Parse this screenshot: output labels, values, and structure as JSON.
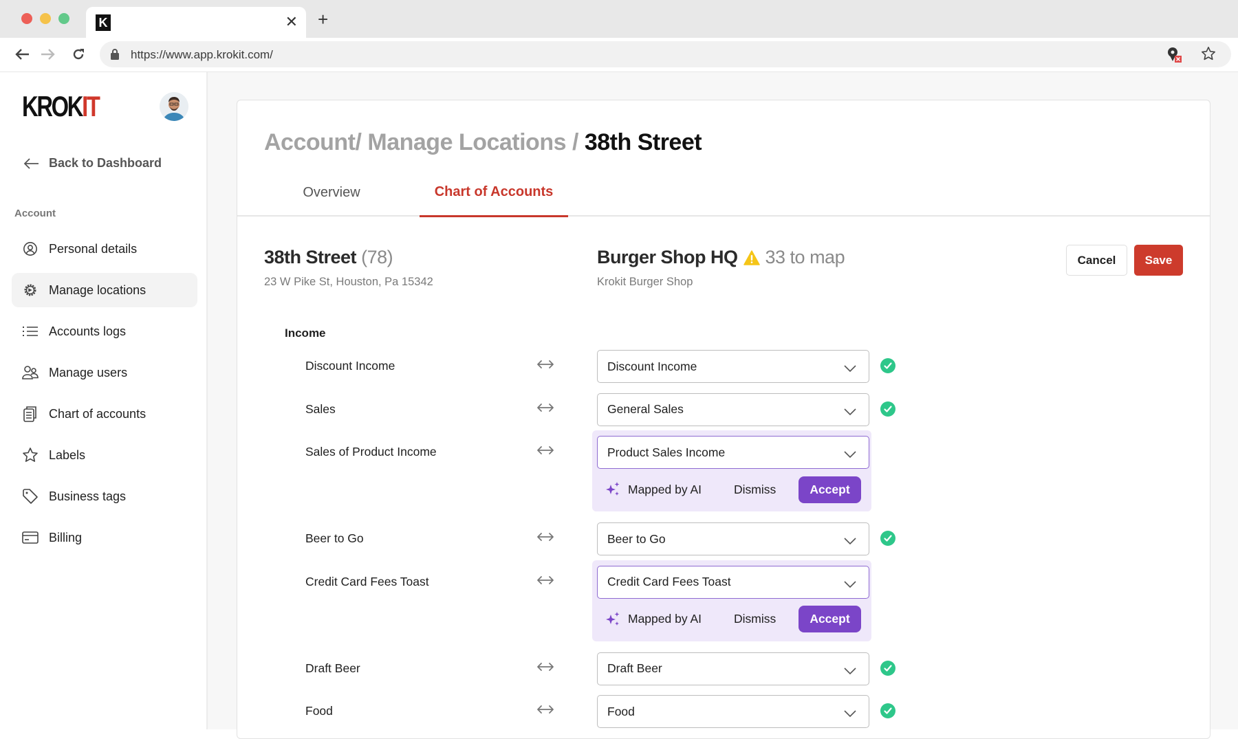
{
  "browser": {
    "tab_favicon": "K",
    "tab_close": "✕",
    "new_tab": "+",
    "url": "https://www.app.krokit.com/",
    "icons": [
      "back-arrow-icon",
      "forward-arrow-icon",
      "reload-icon",
      "lock-icon",
      "extension-blocked-icon",
      "bookmark-star-icon"
    ]
  },
  "sidebar": {
    "logo_part1": "KROK",
    "logo_part2": "IT",
    "back_label": "Back to Dashboard",
    "section_label": "Account",
    "items": [
      {
        "label": "Personal details",
        "icon": "user-circle-icon",
        "active": false
      },
      {
        "label": "Manage locations",
        "icon": "gear-icon",
        "active": true
      },
      {
        "label": "Accounts logs",
        "icon": "list-icon",
        "active": false
      },
      {
        "label": "Manage users",
        "icon": "users-icon",
        "active": false
      },
      {
        "label": "Chart of accounts",
        "icon": "clipboard-icon",
        "active": false
      },
      {
        "label": "Labels",
        "icon": "star-icon",
        "active": false
      },
      {
        "label": "Business tags",
        "icon": "tag-icon",
        "active": false
      },
      {
        "label": "Billing",
        "icon": "credit-card-icon",
        "active": false
      }
    ]
  },
  "header": {
    "breadcrumb_muted": "Account/ Manage Locations / ",
    "breadcrumb_current": "38th Street",
    "tabs": [
      {
        "label": "Overview",
        "active": false
      },
      {
        "label": "Chart of Accounts",
        "active": true
      }
    ]
  },
  "location": {
    "name": "38th Street",
    "count": "(78)",
    "address": "23 W Pike St, Houston, Pa 15342"
  },
  "target": {
    "name": "Burger Shop HQ",
    "to_map": "33 to map",
    "subtitle": "Krokit Burger Shop",
    "warning_icon": "warning-icon"
  },
  "actions": {
    "cancel": "Cancel",
    "save": "Save"
  },
  "mapping": {
    "group_label": "Income",
    "ai_label": "Mapped by AI",
    "dismiss_label": "Dismiss",
    "accept_label": "Accept",
    "rows": [
      {
        "source": "Discount Income",
        "target": "Discount Income",
        "status": "mapped"
      },
      {
        "source": "Sales",
        "target": "General Sales",
        "status": "mapped"
      },
      {
        "source": "Sales of Product Income",
        "target": "Product Sales Income",
        "status": "ai-suggested"
      },
      {
        "source": "Beer to Go",
        "target": "Beer to Go",
        "status": "mapped"
      },
      {
        "source": "Credit Card Fees Toast",
        "target": "Credit Card Fees Toast",
        "status": "ai-suggested"
      },
      {
        "source": "Draft Beer",
        "target": "Draft Beer",
        "status": "mapped"
      },
      {
        "source": "Food",
        "target": "Food",
        "status": "mapped"
      }
    ]
  },
  "colors": {
    "brand_red": "#cd3b2c",
    "ai_purple": "#7b45c8",
    "ai_panel_bg": "#efe8fa",
    "success_green": "#2ec78a",
    "warning_yellow": "#f5c518"
  }
}
